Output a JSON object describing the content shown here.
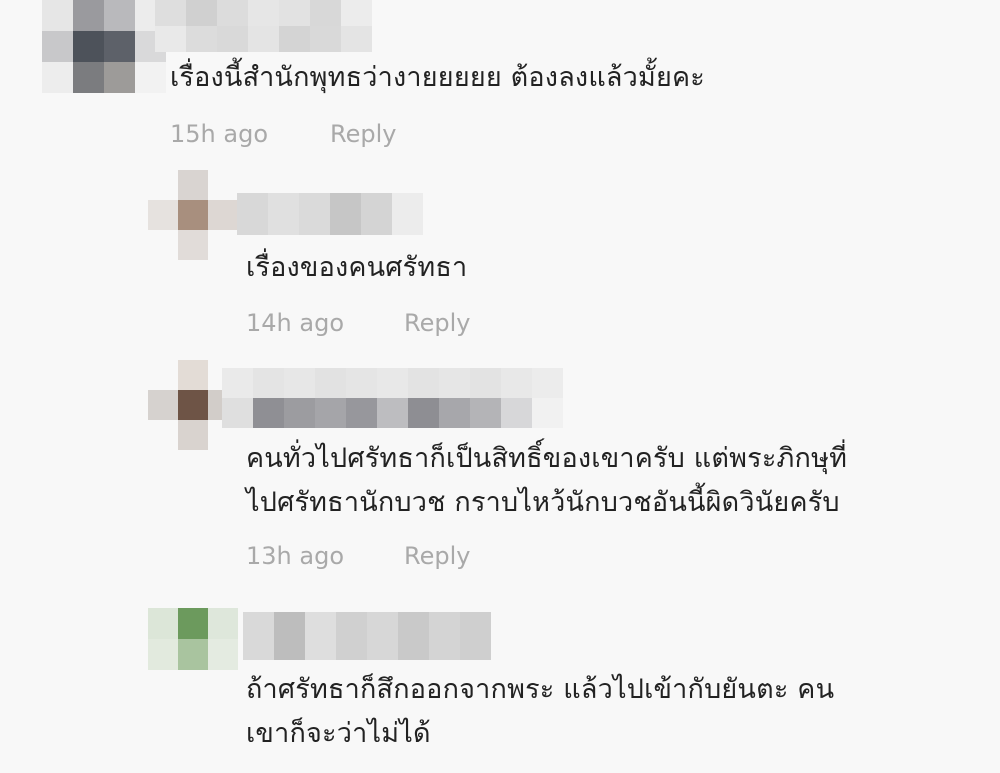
{
  "comments": [
    {
      "text": "เรื่องนี้สำนักพุทธว่างายยยยย ต้องลงแล้วมั้ยคะ",
      "time": "15h ago",
      "reply_label": "Reply"
    },
    {
      "text": "เรื่องของคนศรัทธา",
      "time": "14h ago",
      "reply_label": "Reply"
    },
    {
      "text_line1": "คนทั่วไปศรัทธาก็เป็นสิทธิ์ของเขาครับ แต่พระภิกษุที่",
      "text_line2": "ไปศรัทธานักบวช กราบไหว้นักบวชอันนี้ผิดวินัยครับ",
      "time": "13h ago",
      "reply_label": "Reply"
    },
    {
      "text_line1": "ถ้าศรัทธาก็สึกออกจากพระ แล้วไปเข้ากับยันตะ คน",
      "text_line2": "เขาก็จะว่าไม่ได้"
    }
  ],
  "colors": {
    "background": "#f8f8f8",
    "text": "#222222",
    "meta": "#a9a9a9"
  }
}
